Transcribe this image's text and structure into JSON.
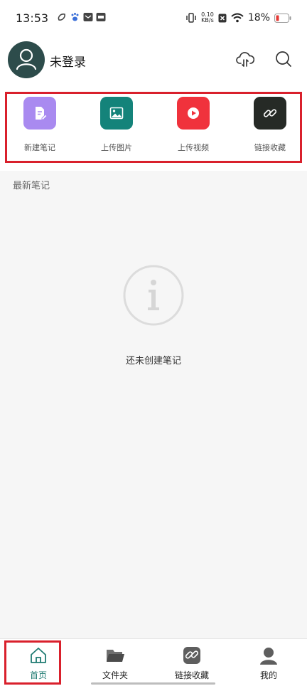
{
  "status_bar": {
    "time": "13:53",
    "net_speed_value": "0.10",
    "net_speed_unit": "KB/s",
    "battery_percent": "18%",
    "icons": [
      "app-notification-icon",
      "paw-icon",
      "mail-icon",
      "archive-icon",
      "vibrate-icon",
      "data-off-icon",
      "wifi-icon",
      "battery-low-icon"
    ]
  },
  "header": {
    "username": "未登录",
    "icons": [
      "avatar-user-icon",
      "cloud-sync-icon",
      "search-icon"
    ]
  },
  "quick_actions": [
    {
      "label": "新建笔记",
      "icon": "new-note-icon",
      "color": "#a98af0"
    },
    {
      "label": "上传图片",
      "icon": "image-icon",
      "color": "#14837a"
    },
    {
      "label": "上传视频",
      "icon": "video-play-icon",
      "color": "#f0323c"
    },
    {
      "label": "链接收藏",
      "icon": "link-icon",
      "color": "#262a26"
    }
  ],
  "section_title": "最新笔记",
  "empty_state": {
    "icon": "info-icon",
    "text": "还未创建笔记"
  },
  "bottom_nav": [
    {
      "label": "首页",
      "icon": "home-icon",
      "active": true
    },
    {
      "label": "文件夹",
      "icon": "folder-icon",
      "active": false
    },
    {
      "label": "链接收藏",
      "icon": "link-bookmark-icon",
      "active": false
    },
    {
      "label": "我的",
      "icon": "profile-icon",
      "active": false
    }
  ],
  "colors": {
    "accent": "#1e7b72",
    "highlight_box": "#d9202c",
    "battery_low": "#e53935"
  }
}
